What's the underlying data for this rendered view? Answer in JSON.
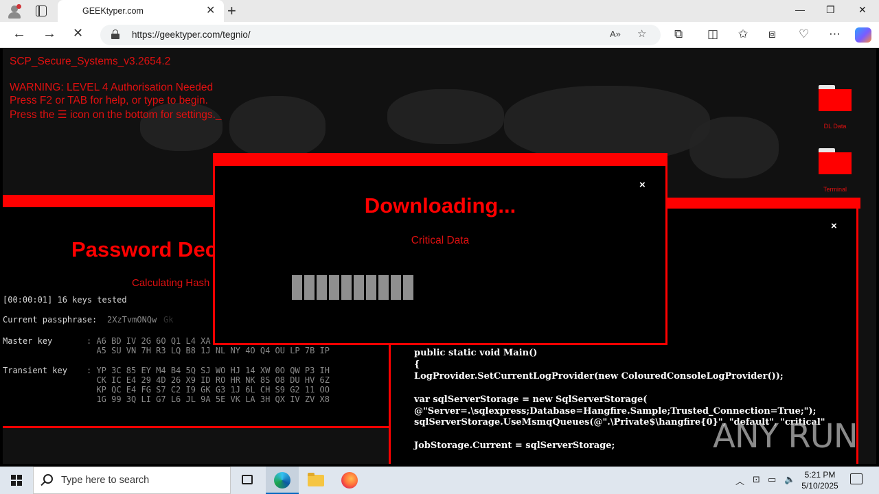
{
  "browser": {
    "tab_title": "GEEKtyper.com",
    "tab_close": "✕",
    "new_tab": "+",
    "url": "https://geektyper.com/tegnio/",
    "window_controls": {
      "minimize": "—",
      "restore": "❐",
      "close": "✕"
    }
  },
  "page": {
    "system_name": "SCP_Secure_Systems_v3.2654.2",
    "warning_lines": [
      "WARNING: LEVEL 4 Authorisation Needed",
      "Press F2 or TAB for help, or type to begin.",
      "Press the ☰ icon on the bottom for settings._"
    ],
    "desktop_icons": [
      {
        "label": "DL Data"
      },
      {
        "label": "Terminal"
      }
    ],
    "password_window": {
      "title": "Password Dec",
      "calculating": "Calculating Hash",
      "keys_tested": "[00:00:01] 16 keys tested",
      "current_passphrase_label": "Current passphrase: ",
      "current_passphrase_value": "2XzTvmONQw",
      "current_passphrase_faded": "Gk",
      "master_key_label": "Master key",
      "master_key_lines": [
        ": A6 BD IV 2G 6O Q1 L4 XA",
        "  A5 SU VN 7H R3 LQ B8 1J NL NY 4O Q4 OU LP 7B IP"
      ],
      "transient_key_label": "Transient key",
      "transient_key_lines": [
        ": YP 3C 85 EY M4 B4 5Q SJ WO HJ 14 XW 0O QW P3 IH",
        "  CK IC E4 29 4D 26 X9 ID RO HR NK 8S O8 DU HV 6Z",
        "  KP QC E4 FG S7 C2 I9 GK G3 1J 6L CH S9 G2 11 OO",
        "  1G 99 3Q LI G7 L6 JL 9A 5E VK LA 3H QX IV ZV X8"
      ]
    },
    "code_window": {
      "close": "×",
      "code_lines": [
        "public static void Main()",
        "{",
        "LogProvider.SetCurrentLogProvider(new ColouredConsoleLogProvider());",
        "",
        "var sqlServerStorage = new SqlServerStorage(",
        "@\"Server=.\\sqlexpress;Database=Hangfire.Sample;Trusted_Connection=True;\");",
        "sqlServerStorage.UseMsmqQueues(@\".\\Private$\\hangfire{0}\", \"default\", \"critical\"",
        "",
        "JobStorage.Current = sqlServerStorage;"
      ]
    },
    "download_modal": {
      "close": "×",
      "title": "Downloading...",
      "subtitle": "Critical Data",
      "progress_segments": 10
    },
    "watermark": "ANY RUN"
  },
  "taskbar": {
    "search_placeholder": "Type here to search",
    "time": "5:21 PM",
    "date": "5/10/2025"
  },
  "colors": {
    "accent_red": "#ff0000",
    "page_bg": "#111111",
    "progress_grey": "#8f8f8f"
  }
}
